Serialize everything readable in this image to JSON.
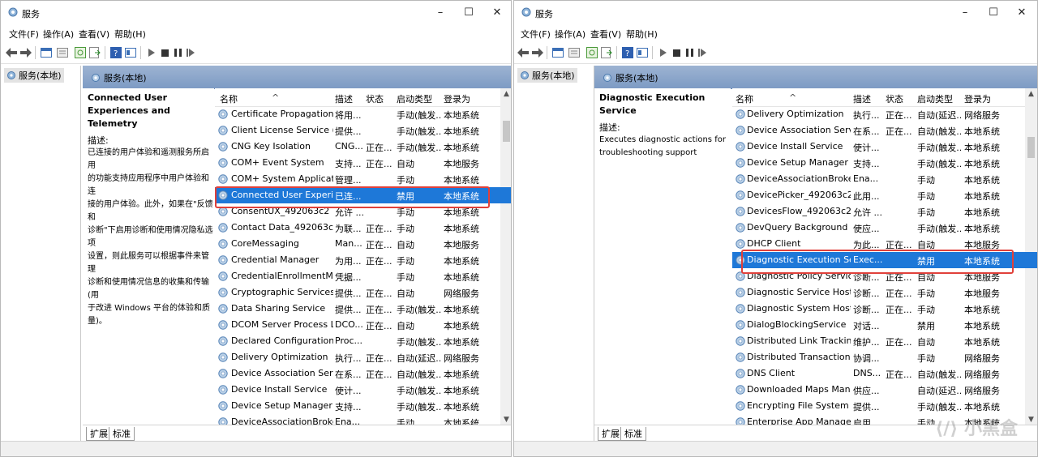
{
  "left": {
    "title": "服务",
    "menu": [
      "文件(F)",
      "操作(A)",
      "查看(V)",
      "帮助(H)"
    ],
    "tree_node": "服务(本地)",
    "header": "服务(本地)",
    "desc_title": "Connected User Experiences and Telemetry",
    "desc_label": "描述:",
    "desc_text": [
      "已连接的用户体验和遥测服务所启用",
      "的功能支持应用程序中用户体验和连",
      "接的用户体验。此外，如果在\"反馈和",
      "诊断\"下启用诊断和使用情况隐私选项",
      "设置，则此服务可以根据事件来管理",
      "诊断和使用情况信息的收集和传输(用",
      "于改进 Windows 平台的体验和质",
      "量)。"
    ],
    "columns": [
      "名称",
      "描述",
      "状态",
      "启动类型",
      "登录为"
    ],
    "rows": [
      [
        "Certificate Propagation",
        "将用...",
        "",
        "手动(触发...",
        "本地系统"
      ],
      [
        "Client License Service (Cli...",
        "提供...",
        "",
        "手动(触发...",
        "本地系统"
      ],
      [
        "CNG Key Isolation",
        "CNG...",
        "正在...",
        "手动(触发...",
        "本地系统"
      ],
      [
        "COM+ Event System",
        "支持...",
        "正在...",
        "自动",
        "本地服务"
      ],
      [
        "COM+ System Application",
        "管理...",
        "",
        "手动",
        "本地系统"
      ],
      [
        "Connected User Experien...",
        "已连...",
        "",
        "禁用",
        "本地系统"
      ],
      [
        "ConsentUX_492063c2",
        "允许 ...",
        "",
        "手动",
        "本地系统"
      ],
      [
        "Contact Data_492063c2",
        "为联...",
        "正在...",
        "手动",
        "本地系统"
      ],
      [
        "CoreMessaging",
        "Man...",
        "正在...",
        "自动",
        "本地服务"
      ],
      [
        "Credential Manager",
        "为用...",
        "正在...",
        "手动",
        "本地系统"
      ],
      [
        "CredentialEnrollmentMan...",
        "凭据...",
        "",
        "手动",
        "本地系统"
      ],
      [
        "Cryptographic Services",
        "提供...",
        "正在...",
        "自动",
        "网络服务"
      ],
      [
        "Data Sharing Service",
        "提供...",
        "正在...",
        "手动(触发...",
        "本地系统"
      ],
      [
        "DCOM Server Process La...",
        "DCO...",
        "正在...",
        "自动",
        "本地系统"
      ],
      [
        "Declared Configuration(...",
        "Proc...",
        "",
        "手动(触发...",
        "本地系统"
      ],
      [
        "Delivery Optimization",
        "执行...",
        "正在...",
        "自动(延迟...",
        "网络服务"
      ],
      [
        "Device Association Service",
        "在系...",
        "正在...",
        "自动(触发...",
        "本地系统"
      ],
      [
        "Device Install Service",
        "使计...",
        "",
        "手动(触发...",
        "本地系统"
      ],
      [
        "Device Setup Manager",
        "支持...",
        "",
        "手动(触发...",
        "本地系统"
      ],
      [
        "DeviceAssociationBroker...",
        "Ena...",
        "",
        "手动",
        "本地系统"
      ]
    ],
    "selected_index": 5,
    "tabs": [
      "扩展",
      "标准"
    ]
  },
  "right": {
    "title": "服务",
    "menu": [
      "文件(F)",
      "操作(A)",
      "查看(V)",
      "帮助(H)"
    ],
    "tree_node": "服务(本地)",
    "header": "服务(本地)",
    "desc_title": "Diagnostic Execution Service",
    "desc_label": "描述:",
    "desc_text": [
      "Executes diagnostic actions for",
      "troubleshooting support"
    ],
    "columns": [
      "名称",
      "描述",
      "状态",
      "启动类型",
      "登录为"
    ],
    "rows": [
      [
        "Delivery Optimization",
        "执行...",
        "正在...",
        "自动(延迟...",
        "网络服务"
      ],
      [
        "Device Association Service",
        "在系...",
        "正在...",
        "自动(触发...",
        "本地系统"
      ],
      [
        "Device Install Service",
        "使计...",
        "",
        "手动(触发...",
        "本地系统"
      ],
      [
        "Device Setup Manager",
        "支持...",
        "",
        "手动(触发...",
        "本地系统"
      ],
      [
        "DeviceAssociationBroker...",
        "Ena...",
        "",
        "手动",
        "本地系统"
      ],
      [
        "DevicePicker_492063c2",
        "此用...",
        "",
        "手动",
        "本地系统"
      ],
      [
        "DevicesFlow_492063c2",
        "允许 ...",
        "",
        "手动",
        "本地系统"
      ],
      [
        "DevQuery Background D...",
        "使应...",
        "",
        "手动(触发...",
        "本地系统"
      ],
      [
        "DHCP Client",
        "为此...",
        "正在...",
        "自动",
        "本地服务"
      ],
      [
        "Diagnostic Execution Ser...",
        "Exec...",
        "",
        "禁用",
        "本地系统"
      ],
      [
        "Diagnostic Policy Service",
        "诊断...",
        "正在...",
        "自动",
        "本地服务"
      ],
      [
        "Diagnostic Service Host",
        "诊断...",
        "正在...",
        "手动",
        "本地服务"
      ],
      [
        "Diagnostic System Host",
        "诊断...",
        "正在...",
        "手动",
        "本地系统"
      ],
      [
        "DialogBlockingService",
        "对话...",
        "",
        "禁用",
        "本地系统"
      ],
      [
        "Distributed Link Tracking...",
        "维护...",
        "正在...",
        "自动",
        "本地系统"
      ],
      [
        "Distributed Transaction C...",
        "协调...",
        "",
        "手动",
        "网络服务"
      ],
      [
        "DNS Client",
        "DNS...",
        "正在...",
        "自动(触发...",
        "网络服务"
      ],
      [
        "Downloaded Maps Man...",
        "供应...",
        "",
        "自动(延迟...",
        "网络服务"
      ],
      [
        "Encrypting File System (E...",
        "提供...",
        "",
        "手动(触发...",
        "本地系统"
      ],
      [
        "Enterprise App Manage...",
        "启用...",
        "",
        "手动",
        "本地系统"
      ]
    ],
    "selected_index": 9,
    "tabs": [
      "扩展",
      "标准"
    ]
  },
  "watermark": "小黑盒",
  "colors": {
    "selection": "#1e78d8",
    "highlight": "#e0403a",
    "header": "#8aa6cc"
  }
}
